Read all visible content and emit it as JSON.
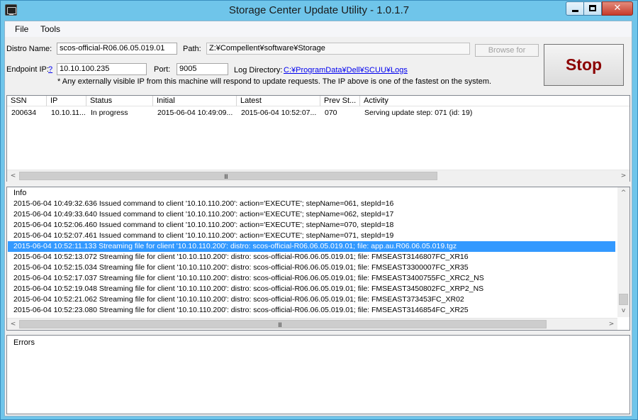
{
  "window": {
    "title": "Storage Center Update Utility - 1.0.1.7"
  },
  "menu": {
    "file": "File",
    "tools": "Tools"
  },
  "form": {
    "distro_label": "Distro Name:",
    "distro_value": "scos-official-R06.06.05.019.01",
    "path_label": "Path:",
    "path_value": "Z:¥Compellent¥software¥Storage",
    "browse_label": "Browse for",
    "endpoint_label": "Endpoint IP:",
    "endpoint_help": "?",
    "endpoint_value": "10.10.100.235",
    "port_label": "Port:",
    "port_value": "9005",
    "logdir_label": "Log Directory:",
    "logdir_value": "C:¥ProgramData¥Dell¥SCUU¥Logs",
    "note": "* Any externally visible IP from this machine will respond to update requests.  The IP above is one of the fastest on the system.",
    "stop_label": "Stop"
  },
  "clients": {
    "columns": [
      "SSN",
      "IP",
      "Status",
      "Initial",
      "Latest",
      "Prev St...",
      "Activity"
    ],
    "rows": [
      {
        "ssn": "200634",
        "ip": "10.10.11...",
        "status": "In progress",
        "initial": "2015-06-04 10:49:09...",
        "latest": "2015-06-04 10:52:07...",
        "prev": "070",
        "activity": "Serving update step: 071 (id: 19)"
      }
    ]
  },
  "info": {
    "title": "Info",
    "lines": [
      "2015-06-04 10:49:32.636 Issued command to client '10.10.110.200': action='EXECUTE'; stepName=061, stepId=16",
      "2015-06-04 10:49:33.640 Issued command to client '10.10.110.200': action='EXECUTE'; stepName=062, stepId=17",
      "2015-06-04 10:52:06.460 Issued command to client '10.10.110.200': action='EXECUTE'; stepName=070, stepId=18",
      "2015-06-04 10:52:07.461 Issued command to client '10.10.110.200': action='EXECUTE'; stepName=071, stepId=19",
      "2015-06-04 10:52:11.133 Streaming file for client '10.10.110.200': distro: scos-official-R06.06.05.019.01; file: app.au.R06.06.05.019.tgz",
      "2015-06-04 10:52:13.072 Streaming file for client '10.10.110.200': distro: scos-official-R06.06.05.019.01; file: FMSEAST3146807FC_XR16",
      "2015-06-04 10:52:15.034 Streaming file for client '10.10.110.200': distro: scos-official-R06.06.05.019.01; file: FMSEAST3300007FC_XR35",
      "2015-06-04 10:52:17.037 Streaming file for client '10.10.110.200': distro: scos-official-R06.06.05.019.01; file: FMSEAST3400755FC_XRC2_NS",
      "2015-06-04 10:52:19.048 Streaming file for client '10.10.110.200': distro: scos-official-R06.06.05.019.01; file: FMSEAST3450802FC_XRP2_NS",
      "2015-06-04 10:52:21.062 Streaming file for client '10.10.110.200': distro: scos-official-R06.06.05.019.01; file: FMSEAST373453FC_XR02",
      "2015-06-04 10:52:23.080 Streaming file for client '10.10.110.200': distro: scos-official-R06.06.05.019.01; file: FMSEAST3146854FC_XR25"
    ],
    "selected_index": 4
  },
  "errors": {
    "title": "Errors"
  },
  "scrollbar": {
    "grip": "III"
  }
}
